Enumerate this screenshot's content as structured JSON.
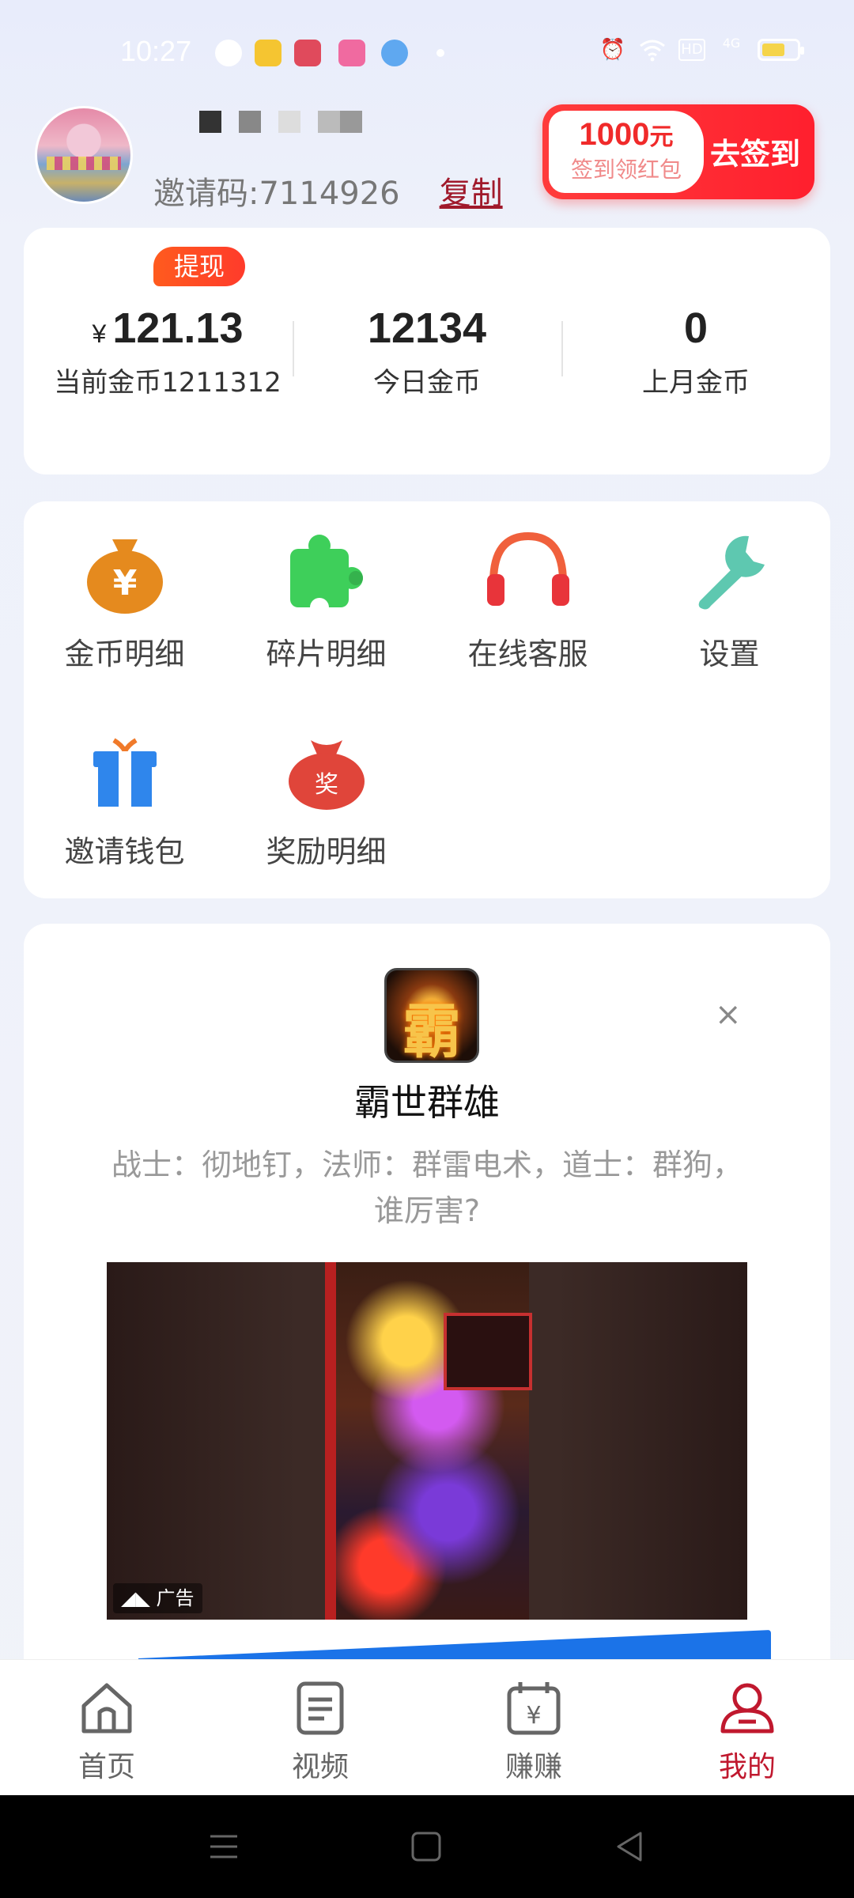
{
  "status_bar": {
    "time": "10:27",
    "icons": [
      "alarm-icon",
      "wifi-icon",
      "hd-icon",
      "signal-icon",
      "battery-icon"
    ],
    "hd_label": "HD",
    "signal_label": "4G"
  },
  "profile": {
    "invite_label": "邀请码:7114926",
    "copy_label": "复制"
  },
  "sign_in": {
    "amount": "1000",
    "unit": "元",
    "subtitle": "签到领红包",
    "action": "去签到"
  },
  "stats": {
    "withdraw_label": "提现",
    "balance_symbol": "¥",
    "balance_value": "121.13",
    "balance_label": "当前金币1211312",
    "today_value": "12134",
    "today_label": "今日金币",
    "last_month_value": "0",
    "last_month_label": "上月金币"
  },
  "menu": {
    "items": [
      {
        "label": "金币明细",
        "icon": "money-bag-icon"
      },
      {
        "label": "碎片明细",
        "icon": "puzzle-icon"
      },
      {
        "label": "在线客服",
        "icon": "headphones-icon"
      },
      {
        "label": "设置",
        "icon": "wrench-icon"
      },
      {
        "label": "邀请钱包",
        "icon": "gift-icon"
      },
      {
        "label": "奖励明细",
        "icon": "reward-bag-icon"
      }
    ],
    "reward_glyph": "奖",
    "money_glyph": "¥"
  },
  "ad": {
    "app_glyph": "霸",
    "title": "霸世群雄",
    "description": "战士：彻地钉，法师：群雷电术，道士：群狗，谁厉害?",
    "tag": "广告",
    "close_glyph": "×"
  },
  "bottom_nav": {
    "items": [
      {
        "label": "首页",
        "icon": "home-icon",
        "active": false
      },
      {
        "label": "视频",
        "icon": "document-icon",
        "active": false
      },
      {
        "label": "赚赚",
        "icon": "calendar-yen-icon",
        "active": false
      },
      {
        "label": "我的",
        "icon": "profile-icon",
        "active": true
      }
    ],
    "yen_glyph": "¥"
  },
  "colors": {
    "brand_red": "#c0182e",
    "sign_red": "#ff2a2a",
    "withdraw_orange": "#ff5b1e",
    "ad_button_blue": "#1b73e8"
  }
}
